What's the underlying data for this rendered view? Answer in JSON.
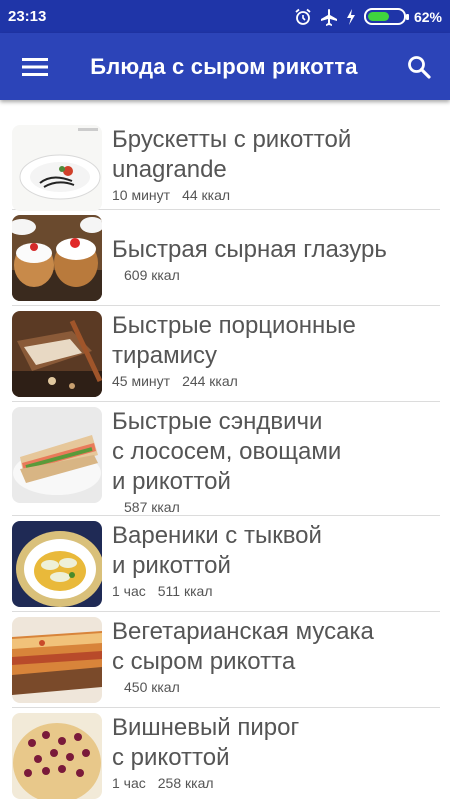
{
  "status": {
    "time": "23:13",
    "battery_pct": "62%",
    "battery_level": 0.62
  },
  "app_bar": {
    "title": "Блюда с сыром рикотта"
  },
  "items": [
    {
      "title": "Брускетты с рикоттой\nunagrande",
      "time": "10 минут",
      "kcal": "44 ккал"
    },
    {
      "title": "Быстрая сырная глазурь",
      "time": "",
      "kcal": "609 ккал"
    },
    {
      "title": "Быстрые порционные\nтирамису",
      "time": "45 минут",
      "kcal": "244 ккал"
    },
    {
      "title": "Быстрые сэндвичи\nс лососем, овощами\nи рикоттой",
      "time": "",
      "kcal": "587 ккал"
    },
    {
      "title": "Вареники с тыквой\nи рикоттой",
      "time": "1 час",
      "kcal": "511 ккал"
    },
    {
      "title": "Вегетарианская мусака\nс сыром рикотта",
      "time": "",
      "kcal": "450 ккал"
    },
    {
      "title": "Вишневый пирог\nс рикоттой",
      "time": "1 час",
      "kcal": "258 ккал"
    }
  ]
}
